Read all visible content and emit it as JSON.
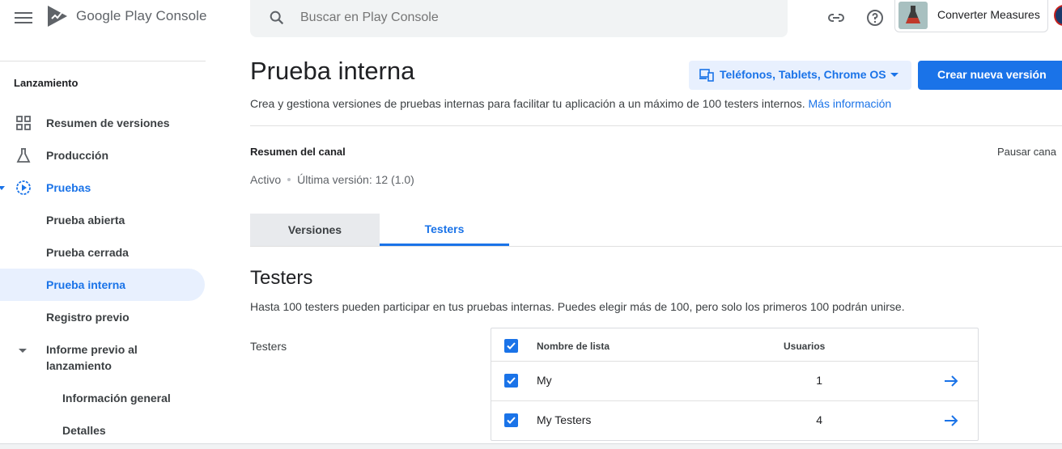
{
  "header": {
    "brand": "Google Play Console",
    "search_placeholder": "Buscar en Play Console",
    "app_name": "Converter Measures",
    "icons": [
      "menu-icon",
      "play-console-logo",
      "search-icon",
      "link-icon",
      "help-icon",
      "app-icon",
      "account-avatar"
    ]
  },
  "sidebar": {
    "section": "Lanzamiento",
    "items": [
      {
        "label": "Resumen de versiones",
        "icon": "dashboard-icon"
      },
      {
        "label": "Producción",
        "icon": "flask-icon"
      },
      {
        "label": "Pruebas",
        "icon": "play-circle-icon"
      },
      {
        "label": "Prueba abierta"
      },
      {
        "label": "Prueba cerrada"
      },
      {
        "label": "Prueba interna"
      },
      {
        "label": "Registro previo"
      },
      {
        "label": "Informe previo al lanzamiento"
      },
      {
        "label": "Información general"
      },
      {
        "label": "Detalles"
      }
    ]
  },
  "main": {
    "title": "Prueba interna",
    "description": "Crea y gestiona versiones de pruebas internas para facilitar tu aplicación a un máximo de 100 testers internos.",
    "more_info": "Más información",
    "device_selector": "Teléfonos, Tablets, Chrome OS",
    "create_button": "Crear nueva versión",
    "channel_summary": "Resumen del canal",
    "pause_channel": "Pausar cana",
    "status": "Activo",
    "latest_version": "Última versión: 12 (1.0)",
    "tabs": [
      "Versiones",
      "Testers"
    ],
    "testers_title": "Testers",
    "testers_desc": "Hasta 100 testers pueden participar en tus pruebas internas. Puedes elegir más de 100, pero solo los primeros 100 podrán unirse.",
    "field_label": "Testers",
    "table": {
      "headers": [
        "Nombre de lista",
        "Usuarios"
      ],
      "rows": [
        {
          "name": "My",
          "users": "1",
          "checked": true
        },
        {
          "name": "My Testers",
          "users": "4",
          "checked": true
        }
      ]
    }
  },
  "colors": {
    "accent": "#1a73e8",
    "active_bg": "#e8f0fe"
  }
}
